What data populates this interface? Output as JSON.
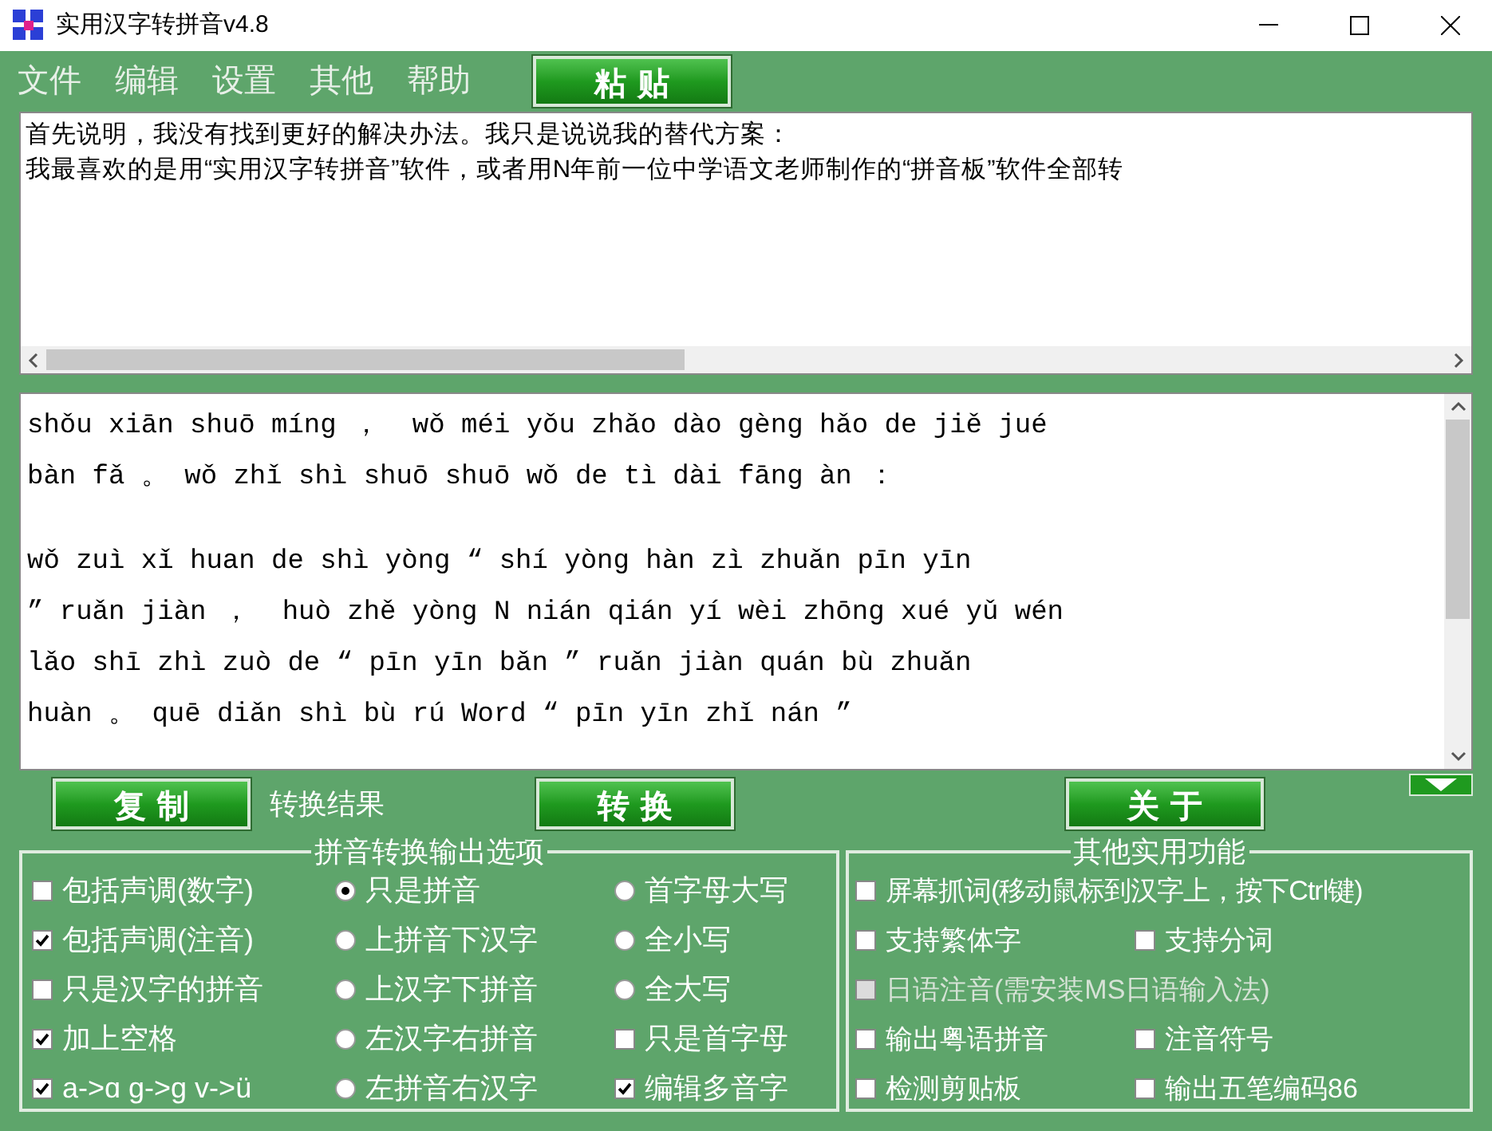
{
  "window": {
    "title": "实用汉字转拼音v4.8"
  },
  "menu": [
    "文件",
    "编辑",
    "设置",
    "其他",
    "帮助"
  ],
  "paste_button": "粘 贴",
  "input_text": [
    "首先说明，我没有找到更好的解决办法。我只是说说我的替代方案：",
    "我最喜欢的是用“实用汉字转拼音”软件，或者用N年前一位中学语文老师制作的“拼音板”软件全部转"
  ],
  "output_paragraphs": [
    [
      "shǒu xiān shuō míng ，  wǒ méi yǒu zhǎo dào gèng hǎo de jiě jué",
      "bàn fǎ 。 wǒ zhǐ shì shuō shuō wǒ de tì dài fāng àn ："
    ],
    [
      "wǒ zuì xǐ huan de shì yòng “ shí yòng hàn zì zhuǎn pīn yīn",
      "” ruǎn jiàn ，  huò zhě yòng N nián qián yí wèi zhōng xué yǔ wén",
      "lǎo shī zhì zuò de “ pīn yīn bǎn ” ruǎn jiàn quán bù zhuǎn",
      "huàn 。 quē diǎn shì bù rú Word “ pīn yīn zhǐ nán ”"
    ]
  ],
  "copy_button": "复 制",
  "result_label": "转换结果",
  "convert_button": "转 换",
  "about_button": "关 于",
  "options_group": {
    "title": "拼音转换输出选项",
    "columns": [
      [
        {
          "kind": "checkbox",
          "label": "包括声调(数字)",
          "checked": false
        },
        {
          "kind": "checkbox",
          "label": "包括声调(注音)",
          "checked": true
        },
        {
          "kind": "checkbox",
          "label": "只是汉字的拼音",
          "checked": false
        },
        {
          "kind": "checkbox",
          "label": "加上空格",
          "checked": true
        },
        {
          "kind": "checkbox",
          "label": "a->ɑ g->ɡ v->ü",
          "checked": true
        }
      ],
      [
        {
          "kind": "radio",
          "label": "只是拼音",
          "selected": true
        },
        {
          "kind": "radio",
          "label": "上拼音下汉字",
          "selected": false
        },
        {
          "kind": "radio",
          "label": "上汉字下拼音",
          "selected": false
        },
        {
          "kind": "radio",
          "label": "左汉字右拼音",
          "selected": false
        },
        {
          "kind": "radio",
          "label": "左拼音右汉字",
          "selected": false
        }
      ],
      [
        {
          "kind": "radio",
          "label": "首字母大写",
          "selected": false
        },
        {
          "kind": "radio",
          "label": "全小写",
          "selected": false
        },
        {
          "kind": "radio",
          "label": "全大写",
          "selected": false
        },
        {
          "kind": "checkbox",
          "label": "只是首字母",
          "checked": false
        },
        {
          "kind": "checkbox",
          "label": "编辑多音字",
          "checked": true
        }
      ]
    ]
  },
  "tools_group": {
    "title": "其他实用功能",
    "rows": [
      [
        {
          "label": "屏幕抓词(移动鼠标到汉字上，按下Ctrl键)",
          "checked": false,
          "disabled": false
        }
      ],
      [
        {
          "label": "支持繁体字",
          "checked": false,
          "disabled": false
        },
        {
          "label": "支持分词",
          "checked": false,
          "disabled": false
        }
      ],
      [
        {
          "label": "日语注音(需安装MS日语输入法)",
          "checked": false,
          "disabled": true
        }
      ],
      [
        {
          "label": "输出粤语拼音",
          "checked": false,
          "disabled": false
        },
        {
          "label": "注音符号",
          "checked": false,
          "disabled": false
        }
      ],
      [
        {
          "label": "检测剪贴板",
          "checked": false,
          "disabled": false
        },
        {
          "label": "输出五笔编码86",
          "checked": false,
          "disabled": false
        }
      ]
    ]
  }
}
